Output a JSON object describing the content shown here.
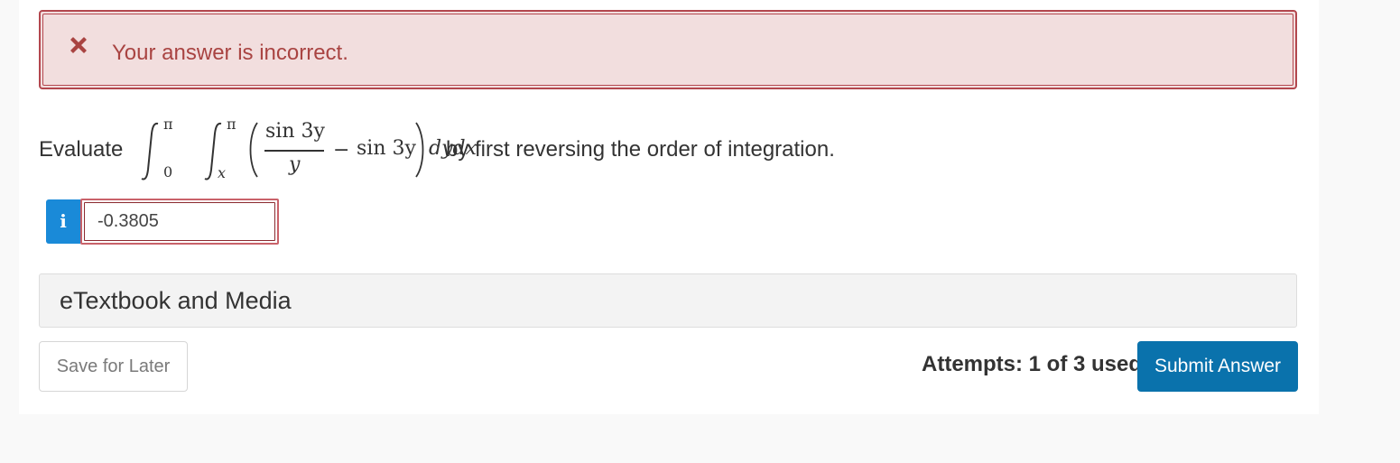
{
  "alert": {
    "icon": "close-icon",
    "message": "Your answer is incorrect.",
    "color": "#a94442",
    "background": "#f2dede"
  },
  "question": {
    "lead": "Evaluate",
    "trail": "by first reversing the order of integration.",
    "math": {
      "outer_upper": "π",
      "outer_lower": "0",
      "inner_upper": "π",
      "inner_lower": "x",
      "numerator": "sin 3y",
      "denominator": "y",
      "minus": "−",
      "term": "sin 3y",
      "differential": "dydx"
    }
  },
  "answer": {
    "info_icon": "info-icon",
    "info_glyph": "i",
    "value": "-0.3805"
  },
  "media": {
    "label": "eTextbook and Media"
  },
  "footer": {
    "save_label": "Save for Later",
    "attempts": "Attempts: 1 of 3 used",
    "submit_label": "Submit Answer",
    "submit_color": "#0a72ac"
  }
}
